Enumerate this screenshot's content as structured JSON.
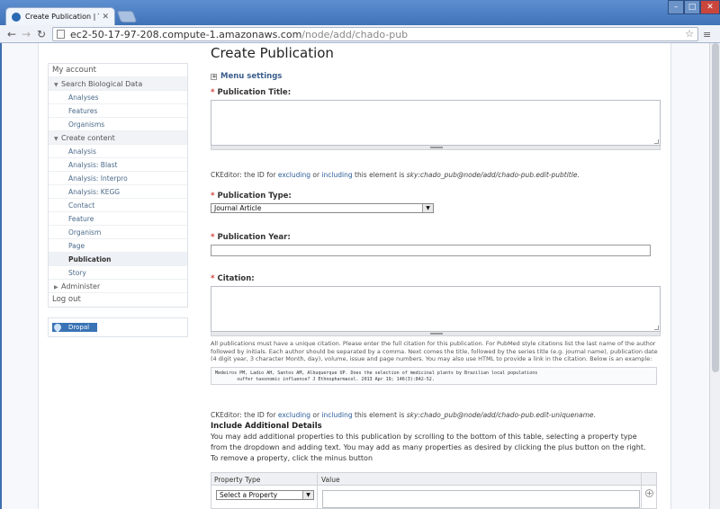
{
  "browser": {
    "tab_title": "Create Publication | Tripal",
    "url_host": "ec2-50-17-97-208.compute-1.amazonaws.com",
    "url_path": "/node/add/chado-pub",
    "icons": {
      "favicon": "drupal-drop-icon",
      "back": "back-arrow-icon",
      "forward": "forward-arrow-icon",
      "reload": "reload-icon",
      "page": "page-icon",
      "star": "star-icon",
      "menu": "wrench-menu-icon"
    }
  },
  "sidebar": {
    "items": [
      {
        "label": "My account",
        "level": 0
      },
      {
        "label": "Search Biological Data",
        "level": 1,
        "expanded": true
      },
      {
        "label": "Analyses",
        "level": 2
      },
      {
        "label": "Features",
        "level": 2
      },
      {
        "label": "Organisms",
        "level": 2
      },
      {
        "label": "Create content",
        "level": 1,
        "expanded": true
      },
      {
        "label": "Analysis",
        "level": 2
      },
      {
        "label": "Analysis: Blast",
        "level": 2
      },
      {
        "label": "Analysis: Interpro",
        "level": 2
      },
      {
        "label": "Analysis: KEGG",
        "level": 2
      },
      {
        "label": "Contact",
        "level": 2
      },
      {
        "label": "Feature",
        "level": 2
      },
      {
        "label": "Organism",
        "level": 2
      },
      {
        "label": "Page",
        "level": 2
      },
      {
        "label": "Publication",
        "level": 2,
        "active": true
      },
      {
        "label": "Story",
        "level": 2
      },
      {
        "label": "Administer",
        "level": 1,
        "expanded": false
      },
      {
        "label": "Log out",
        "level": 0
      }
    ],
    "powered_by": "Dropal"
  },
  "main": {
    "title": "Create Publication",
    "menu_settings": "Menu settings",
    "required_marker": "*",
    "fields": {
      "title_label": "Publication Title:",
      "type_label": "Publication Type:",
      "type_value": "Journal Article",
      "year_label": "Publication Year:",
      "citation_label": "Citation:"
    },
    "ckeditor_title": {
      "prefix": "CKEditor: the ID for ",
      "link_excluding": "excluding",
      "or": " or ",
      "link_including": "including",
      "middle": " this element is ",
      "id": "sky:chado_pub@node/add/chado-pub.edit-pubtitle",
      "suffix": "."
    },
    "ckeditor_unique": {
      "prefix": "CKEditor: the ID for ",
      "link_excluding": "excluding",
      "or": " or ",
      "link_including": "including",
      "middle": " this element is ",
      "id": "sky:chado_pub@node/add/chado-pub.edit-uniquename",
      "suffix": "."
    },
    "citation_description": "All publications must have a unique citation. Please enter the full citation for this publication. For PubMed style citations list the last name of the author followed by initials. Each author should be separated by a comma. Next comes the title, followed by the series title (e.g. journal name), publication date (4 digit year, 3 character Month, day), volume, issue and page numbers. You may also use HTML to provide a link in the citation. Below is an example:",
    "citation_example": "Medeiros PM, Ladio AH, Santos AM, Albuquerque UP. Does the selection of medicinal plants by Brazilian local populations\n        suffer taxonomic influence? J Ethnopharmacol. 2013 Apr 19; 146(3):842-52.",
    "additional": {
      "title": "Include Additional Details",
      "description": "You may add additional properties to this publication by scrolling to the bottom of this table, selecting a property type from the dropdown and adding text. You may add as many properties as desired by clicking the plus button on the right. To remove a property, click the minus button",
      "col_type": "Property Type",
      "col_value": "Value",
      "select_placeholder": "Select a Property"
    }
  }
}
